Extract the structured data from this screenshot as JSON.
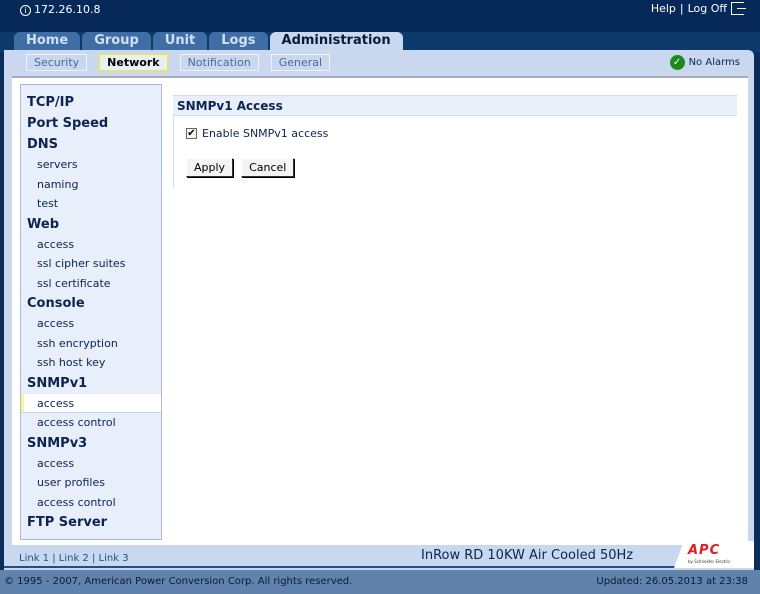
{
  "header": {
    "ip": "172.26.10.8",
    "help": "Help",
    "separator": "|",
    "logoff": "Log Off"
  },
  "tabs": [
    {
      "label": "Home"
    },
    {
      "label": "Group"
    },
    {
      "label": "Unit"
    },
    {
      "label": "Logs"
    },
    {
      "label": "Administration",
      "active": true
    }
  ],
  "subtabs": [
    {
      "label": "Security"
    },
    {
      "label": "Network",
      "active": true
    },
    {
      "label": "Notification"
    },
    {
      "label": "General"
    }
  ],
  "status": {
    "alarms": "No Alarms",
    "color": "#1d8a1d"
  },
  "sidebar": [
    {
      "type": "h",
      "label": "TCP/IP"
    },
    {
      "type": "h",
      "label": "Port Speed"
    },
    {
      "type": "h",
      "label": "DNS"
    },
    {
      "type": "s",
      "label": "servers"
    },
    {
      "type": "s",
      "label": "naming"
    },
    {
      "type": "s",
      "label": "test"
    },
    {
      "type": "h",
      "label": "Web"
    },
    {
      "type": "s",
      "label": "access"
    },
    {
      "type": "s",
      "label": "ssl cipher suites"
    },
    {
      "type": "s",
      "label": "ssl certificate"
    },
    {
      "type": "h",
      "label": "Console"
    },
    {
      "type": "s",
      "label": "access"
    },
    {
      "type": "s",
      "label": "ssh encryption"
    },
    {
      "type": "s",
      "label": "ssh host key"
    },
    {
      "type": "h",
      "label": "SNMPv1"
    },
    {
      "type": "s",
      "label": "access",
      "selected": true
    },
    {
      "type": "s",
      "label": "access control"
    },
    {
      "type": "h",
      "label": "SNMPv3"
    },
    {
      "type": "s",
      "label": "access"
    },
    {
      "type": "s",
      "label": "user profiles"
    },
    {
      "type": "s",
      "label": "access control"
    },
    {
      "type": "h",
      "label": "FTP Server"
    }
  ],
  "main": {
    "title": "SNMPv1 Access",
    "checkbox_label": "Enable SNMPv1 access",
    "checked": true,
    "apply": "Apply",
    "cancel": "Cancel"
  },
  "footer": {
    "links": [
      "Link 1",
      "Link 2",
      "Link 3"
    ],
    "model": "InRow RD 10KW Air Cooled 50Hz",
    "logo": "APC",
    "logo_sub": "by Schneider Electric",
    "copyright": "© 1995 - 2007, American Power Conversion Corp. All rights reserved.",
    "updated": "Updated: 26.05.2013 at 23:38"
  }
}
